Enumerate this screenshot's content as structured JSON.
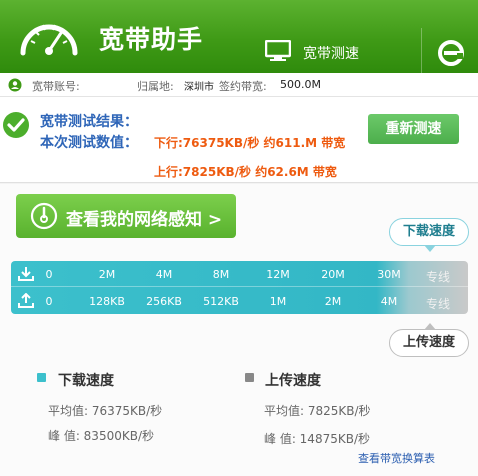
{
  "header": {
    "app_title": "宽带助手",
    "tab_test_label": "宽带测速",
    "brand_color": "#3f9a16"
  },
  "account": {
    "account_label": "宽带账号:",
    "location_label": "归属地:",
    "location_value": "深圳市",
    "contract_label": "签约带宽:",
    "contract_value": "500.0M"
  },
  "result": {
    "title": "宽带测试结果：",
    "subtitle": "本次测试数值：",
    "download_text": "下行:76375KB/秒 约611.M 带宽",
    "upload_text": "上行:7825KB/秒 约62.6M 带宽",
    "retest_label": "重新测速"
  },
  "network_button_label": "查看我的网络感知 >",
  "scale": {
    "download_bubble": "下载速度",
    "upload_bubble": "上传速度",
    "download_ticks": [
      "0",
      "2M",
      "4M",
      "8M",
      "12M",
      "20M",
      "30M",
      "专线"
    ],
    "upload_ticks": [
      "0",
      "128KB",
      "256KB",
      "512KB",
      "1M",
      "2M",
      "4M",
      "专线"
    ],
    "colors": {
      "download": "#3cc0cc",
      "upload": "#888888"
    }
  },
  "stats": {
    "download": {
      "title": "下载速度",
      "avg": "平均值:  76375KB/秒",
      "peak": "峰  值:  83500KB/秒"
    },
    "upload": {
      "title": "上传速度",
      "avg": "平均值:  7825KB/秒",
      "peak": "峰  值:  14875KB/秒"
    }
  },
  "conversion_link": "查看带宽换算表"
}
